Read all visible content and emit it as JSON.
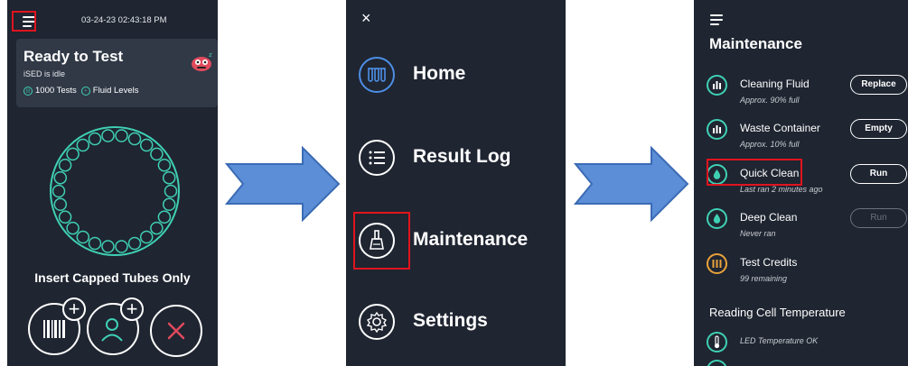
{
  "screen_home": {
    "timestamp": "03-24-23 02:43:18 PM",
    "status_title": "Ready to Test",
    "status_sub": "iSED is idle",
    "tests_count": "1000 Tests",
    "fluid_levels": "Fluid Levels",
    "instruction": "Insert Capped Tubes Only"
  },
  "screen_menu": {
    "close_glyph": "×",
    "items": [
      {
        "label": "Home"
      },
      {
        "label": "Result Log"
      },
      {
        "label": "Maintenance"
      },
      {
        "label": "Settings"
      }
    ]
  },
  "screen_maintenance": {
    "title": "Maintenance",
    "items": [
      {
        "name": "Cleaning Fluid",
        "sub": "Approx. 90% full",
        "action": "Replace"
      },
      {
        "name": "Waste Container",
        "sub": "Approx. 10% full",
        "action": "Empty"
      },
      {
        "name": "Quick Clean",
        "sub": "Last ran 2 minutes ago",
        "action": "Run"
      },
      {
        "name": "Deep Clean",
        "sub": "Never ran",
        "action": "Run"
      },
      {
        "name": "Test Credits",
        "sub": "99 remaining"
      }
    ],
    "section_title": "Reading Cell Temperature",
    "temperature_status": "LED Temperature OK"
  },
  "colors": {
    "background": "#1f2531",
    "accent": "#3fd0b4",
    "highlight": "#e0141e",
    "arrow": "#5b8ed6"
  }
}
